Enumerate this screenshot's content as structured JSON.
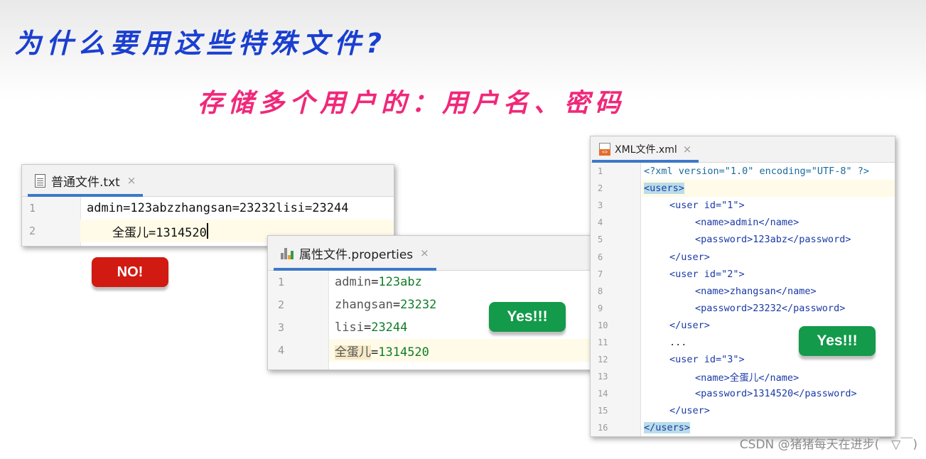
{
  "slide": {
    "title": "为什么要用这些特殊文件?",
    "subtitle": "存储多个用户的：用户名、密码"
  },
  "txt_editor": {
    "tab_label": "普通文件.txt",
    "close": "×",
    "lines": [
      {
        "num": "1",
        "text": "admin=123abzzhangsan=23232lisi=23244"
      },
      {
        "num": "2",
        "text": "全蛋儿=1314520"
      }
    ]
  },
  "props_editor": {
    "tab_label": "属性文件.properties",
    "close": "×",
    "lines": [
      {
        "num": "1",
        "key": "admin",
        "eq": "=",
        "value": "123abz"
      },
      {
        "num": "2",
        "key": "zhangsan",
        "eq": "=",
        "value": "23232"
      },
      {
        "num": "3",
        "key": "lisi",
        "eq": "=",
        "value": "23244"
      },
      {
        "num": "4",
        "key": "全蛋儿",
        "eq": "=",
        "value": "1314520"
      }
    ]
  },
  "xml_editor": {
    "tab_label": "XML文件.xml",
    "close": "×",
    "lines": [
      {
        "num": "1",
        "text": "<?xml version=\"1.0\" encoding=\"UTF-8\" ?>"
      },
      {
        "num": "2",
        "text": "<users>"
      },
      {
        "num": "3",
        "text": "<user id=\"1\">"
      },
      {
        "num": "4",
        "text": "<name>admin</name>"
      },
      {
        "num": "5",
        "text": "<password>123abz</password>"
      },
      {
        "num": "6",
        "text": "</user>"
      },
      {
        "num": "7",
        "text": "<user id=\"2\">"
      },
      {
        "num": "8",
        "text": "<name>zhangsan</name>"
      },
      {
        "num": "9",
        "text": "<password>23232</password>"
      },
      {
        "num": "10",
        "text": "</user>"
      },
      {
        "num": "11",
        "text": "..."
      },
      {
        "num": "12",
        "text": "<user id=\"3\">"
      },
      {
        "num": "13",
        "text": "<name>全蛋儿</name>"
      },
      {
        "num": "14",
        "text": "<password>1314520</password>"
      },
      {
        "num": "15",
        "text": "</user>"
      },
      {
        "num": "16",
        "text": "</users>"
      }
    ]
  },
  "badges": {
    "no": "NO!",
    "yes_props": "Yes!!!",
    "yes_xml": "Yes!!!"
  },
  "colors": {
    "no_badge": "#d11a12",
    "yes_badge": "#139a4a",
    "title": "#1a3fd0",
    "subtitle": "#f0287a"
  },
  "watermark": "CSDN @猪猪每天在进步(￣▽￣)"
}
